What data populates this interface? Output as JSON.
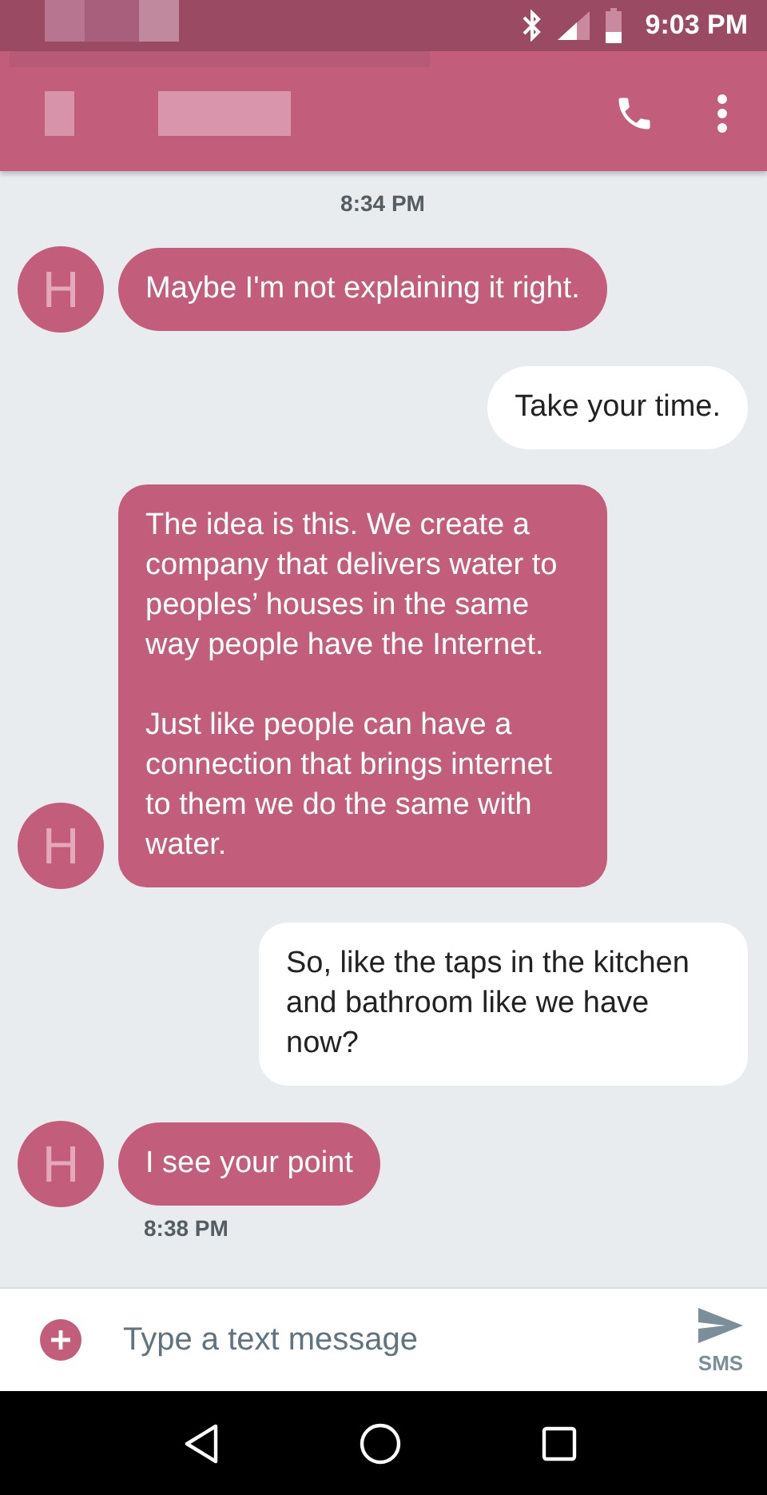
{
  "status_bar": {
    "time": "9:03 PM"
  },
  "conversation": [
    {
      "kind": "timestamp",
      "text": "8:34 PM"
    },
    {
      "kind": "incoming",
      "avatar": "H",
      "text": "Maybe I'm not explaining it right."
    },
    {
      "kind": "outgoing",
      "text": "Take your time."
    },
    {
      "kind": "incoming",
      "avatar": "H",
      "text": "The idea is this. We create a company that delivers water to peoples’ houses in the same way people have the Internet.\n\nJust like people can have a connection that brings internet to them we do the same with water."
    },
    {
      "kind": "outgoing",
      "text": "So, like the taps in the kitchen and bathroom like we have now?"
    },
    {
      "kind": "incoming",
      "avatar": "H",
      "text": "I see your point",
      "time": "8:38 PM"
    }
  ],
  "composer": {
    "placeholder": "Type a text message",
    "send_label": "SMS"
  }
}
